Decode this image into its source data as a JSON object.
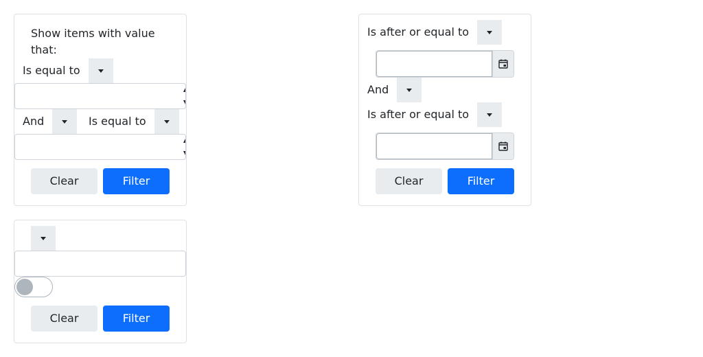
{
  "numeric_filter": {
    "info_text": "Show items with value that:",
    "operator_1": "Is equal to",
    "value_1": "",
    "logic": "And",
    "operator_2": "Is equal to",
    "value_2": "",
    "clear_label": "Clear",
    "filter_label": "Filter"
  },
  "date_filter": {
    "operator_1": "Is after or equal to",
    "value_1": "",
    "logic": "And",
    "operator_2": "Is after or equal to",
    "value_2": "",
    "clear_label": "Clear",
    "filter_label": "Filter"
  },
  "boolean_filter": {
    "operator": "",
    "value": "",
    "toggle_on": false,
    "clear_label": "Clear",
    "filter_label": "Filter"
  },
  "colors": {
    "primary": "#0d6efd",
    "secondary": "#e9ecef",
    "border": "#dee2e6"
  },
  "icons": {
    "dropdown": "caret-down-icon",
    "calendar": "calendar-icon"
  }
}
